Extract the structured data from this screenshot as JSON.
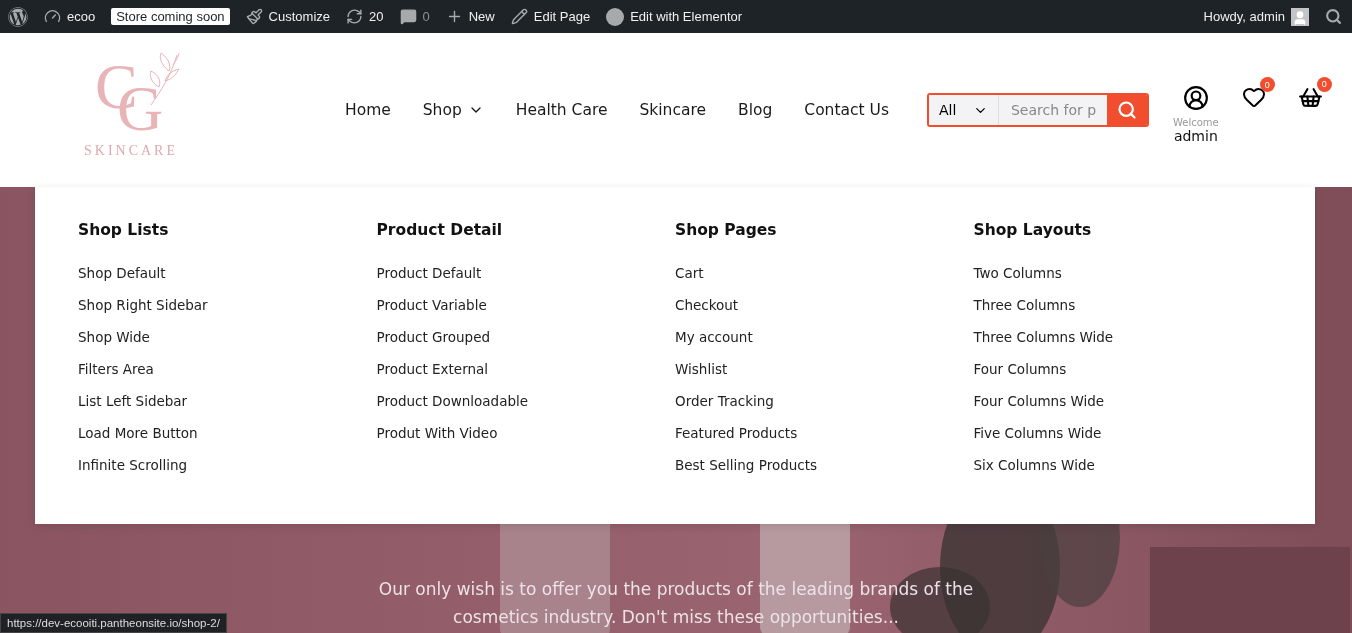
{
  "admin_bar": {
    "items": [
      {
        "kind": "wp"
      },
      {
        "kind": "site",
        "label": "ecoo"
      },
      {
        "kind": "badge",
        "label": "Store coming soon"
      },
      {
        "kind": "customize",
        "label": "Customize"
      },
      {
        "kind": "updates",
        "label": "20"
      },
      {
        "kind": "comments",
        "label": "0"
      },
      {
        "kind": "new",
        "label": "New"
      },
      {
        "kind": "edit",
        "label": "Edit Page"
      },
      {
        "kind": "elementor",
        "label": "Edit with Elementor"
      }
    ],
    "greeting": "Howdy, admin"
  },
  "logo": {
    "monogram": [
      "C",
      "G"
    ],
    "wordmark": "SKINCARE"
  },
  "nav": [
    {
      "label": "Home",
      "dropdown": false
    },
    {
      "label": "Shop",
      "dropdown": true
    },
    {
      "label": "Health Care",
      "dropdown": false
    },
    {
      "label": "Skincare",
      "dropdown": false
    },
    {
      "label": "Blog",
      "dropdown": false
    },
    {
      "label": "Contact Us",
      "dropdown": false
    }
  ],
  "search": {
    "category": "All",
    "placeholder": "Search for p"
  },
  "account": {
    "welcome": "Welcome",
    "name": "admin"
  },
  "wishlist_count": "0",
  "cart_count": "0",
  "mega_menu": [
    {
      "title": "Shop Lists",
      "items": [
        "Shop Default",
        "Shop Right Sidebar",
        "Shop Wide",
        "Filters Area",
        "List Left Sidebar",
        "Load More Button",
        "Infinite Scrolling"
      ]
    },
    {
      "title": "Product Detail",
      "items": [
        "Product Default",
        "Product Variable",
        "Product Grouped",
        "Product External",
        "Product Downloadable",
        "Produt With Video"
      ]
    },
    {
      "title": "Shop Pages",
      "items": [
        "Cart",
        "Checkout",
        "My account",
        "Wishlist",
        "Order Tracking",
        "Featured Products",
        "Best Selling Products"
      ]
    },
    {
      "title": "Shop Layouts",
      "items": [
        "Two Columns",
        "Three Columns",
        "Three Columns Wide",
        "Four Columns",
        "Four Columns Wide",
        "Five Columns Wide",
        "Six Columns Wide"
      ]
    }
  ],
  "hero": {
    "text": "Our only wish is to offer you the products of the leading brands of the cosmetics industry. Don't miss these opportunities..."
  },
  "status_url": "https://dev-ecooiti.pantheonsite.io/shop-2/"
}
